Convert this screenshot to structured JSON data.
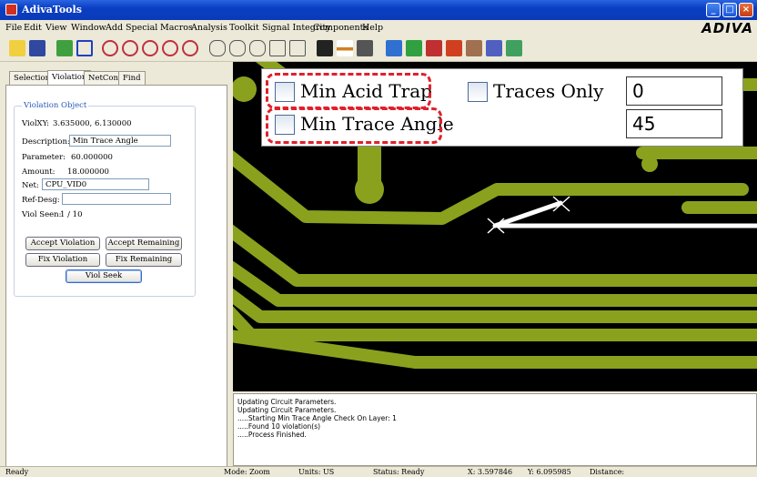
{
  "window": {
    "title": "AdivaTools",
    "brand": "ADIVA"
  },
  "menu": [
    "File",
    "Edit",
    "View",
    "Window",
    "Add",
    "Special",
    "Macros",
    "Analysis",
    "Toolkit",
    "Signal Integrity",
    "Components",
    "Help"
  ],
  "left_panel": {
    "tabs": [
      "Selection",
      "Violation",
      "NetConn",
      "Find"
    ],
    "active_tab": "Violation",
    "group_title": "Violation Object",
    "viol_xy_label": "ViolXY:",
    "viol_xy_value": "3.635000, 6.130000",
    "description_label": "Description:",
    "description_value": "Min Trace Angle",
    "parameter_label": "Parameter:",
    "parameter_value": "60.000000",
    "amount_label": "Amount:",
    "amount_value": "18.000000",
    "net_label": "Net:",
    "net_value": "CPU_VID0",
    "ref_desg_label": "Ref-Desg:",
    "ref_desg_value": "",
    "viol_seen_label": "Viol Seen:",
    "viol_seen_value": "1 / 10",
    "buttons": {
      "accept_violation": "Accept Violation",
      "accept_remaining": "Accept Remaining",
      "fix_violation": "Fix Violation",
      "fix_remaining": "Fix Remaining",
      "viol_seek": "Viol Seek"
    }
  },
  "callout": {
    "min_acid_trap_label": "Min Acid Trap",
    "traces_only_label": "Traces Only",
    "acid_trap_value": "0",
    "min_trace_angle_label": "Min Trace Angle",
    "trace_angle_value": "45"
  },
  "output_log": [
    "Updating Circuit Parameters.",
    "Updating Circuit Parameters.",
    ".....Starting Min Trace Angle Check On Layer: 1",
    ".....Found 10 violation(s)",
    ".....Process Finished."
  ],
  "status": {
    "ready": "Ready",
    "mode": "Mode: Zoom",
    "units": "Units: US",
    "status": "Status: Ready",
    "x": "X: 3.597846",
    "y": "Y: 6.095985",
    "distance": "Distance:"
  },
  "colors": {
    "trace": "#8aa11e",
    "background": "#000000",
    "highlight": "#e0202a"
  }
}
